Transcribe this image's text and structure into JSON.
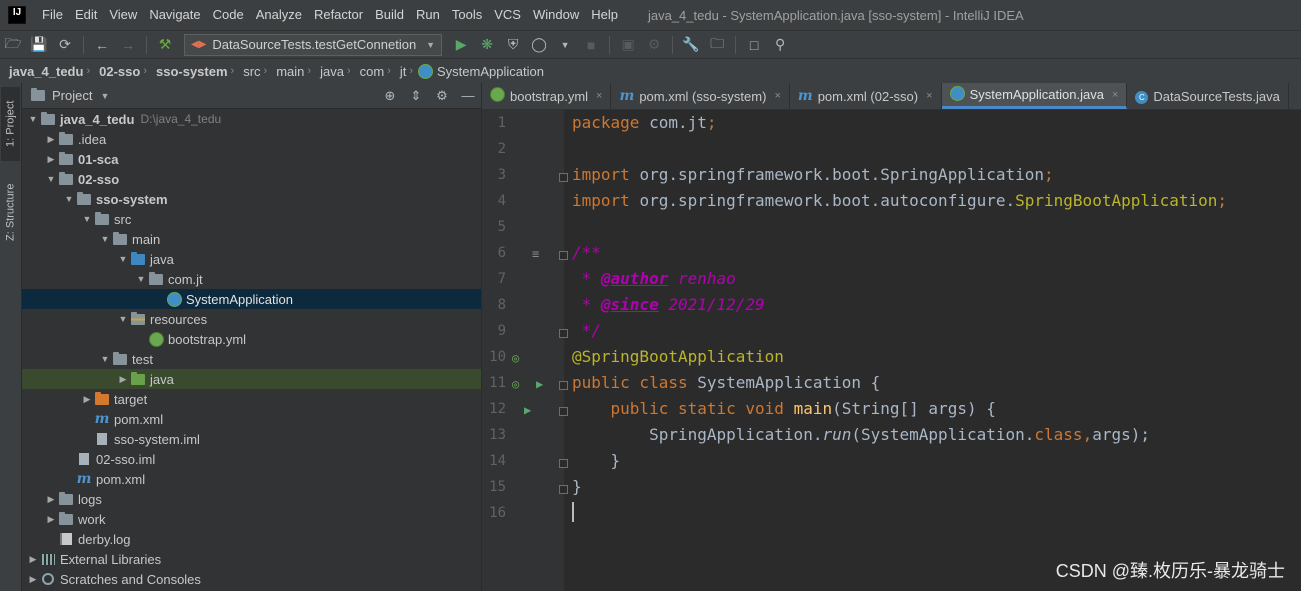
{
  "menubar": {
    "logo": "IJ",
    "items": [
      "File",
      "Edit",
      "View",
      "Navigate",
      "Code",
      "Analyze",
      "Refactor",
      "Build",
      "Run",
      "Tools",
      "VCS",
      "Window",
      "Help"
    ],
    "window_title": "java_4_tedu - SystemApplication.java [sso-system] - IntelliJ IDEA"
  },
  "toolbar": {
    "run_config": "DataSourceTests.testGetConnetion"
  },
  "navbar": {
    "crumbs": [
      "java_4_tedu",
      "02-sso",
      "sso-system",
      "src",
      "main",
      "java",
      "com",
      "jt",
      "SystemApplication"
    ]
  },
  "stripe": {
    "project_tab": "1: Project",
    "structure_tab": "Z: Structure"
  },
  "project_panel": {
    "title": "Project",
    "root_path": "D:\\java_4_tedu",
    "tree": [
      {
        "label": "java_4_tedu",
        "depth": 0,
        "open": true,
        "icon": "folder-gray",
        "bold": true
      },
      {
        "label": ".idea",
        "depth": 1,
        "open": false,
        "icon": "folder-gray"
      },
      {
        "label": "01-sca",
        "depth": 1,
        "open": false,
        "icon": "folder-gray",
        "bold": true
      },
      {
        "label": "02-sso",
        "depth": 1,
        "open": true,
        "icon": "folder-gray",
        "bold": true
      },
      {
        "label": "sso-system",
        "depth": 2,
        "open": true,
        "icon": "folder-gray",
        "bold": true
      },
      {
        "label": "src",
        "depth": 3,
        "open": true,
        "icon": "folder-gray"
      },
      {
        "label": "main",
        "depth": 4,
        "open": true,
        "icon": "folder-gray"
      },
      {
        "label": "java",
        "depth": 5,
        "open": true,
        "icon": "folder-blue"
      },
      {
        "label": "com.jt",
        "depth": 6,
        "open": true,
        "icon": "folder-gray"
      },
      {
        "label": "SystemApplication",
        "depth": 7,
        "leaf": true,
        "icon": "spring-class",
        "selected": true
      },
      {
        "label": "resources",
        "depth": 5,
        "open": true,
        "icon": "folder-resources"
      },
      {
        "label": "bootstrap.yml",
        "depth": 6,
        "leaf": true,
        "icon": "spring-leaf"
      },
      {
        "label": "test",
        "depth": 4,
        "open": true,
        "icon": "folder-gray"
      },
      {
        "label": "java",
        "depth": 5,
        "open": false,
        "icon": "folder-green",
        "highlight": true
      },
      {
        "label": "target",
        "depth": 3,
        "open": false,
        "icon": "folder-orange"
      },
      {
        "label": "pom.xml",
        "depth": 3,
        "leaf": true,
        "icon": "maven"
      },
      {
        "label": "sso-system.iml",
        "depth": 3,
        "leaf": true,
        "icon": "file"
      },
      {
        "label": "02-sso.iml",
        "depth": 2,
        "leaf": true,
        "icon": "file"
      },
      {
        "label": "pom.xml",
        "depth": 2,
        "leaf": true,
        "icon": "maven"
      },
      {
        "label": "logs",
        "depth": 1,
        "open": false,
        "icon": "folder-gray"
      },
      {
        "label": "work",
        "depth": 1,
        "open": false,
        "icon": "folder-gray"
      },
      {
        "label": "derby.log",
        "depth": 1,
        "leaf": true,
        "icon": "log"
      },
      {
        "label": "External Libraries",
        "depth": 0,
        "open": false,
        "icon": "library"
      },
      {
        "label": "Scratches and Consoles",
        "depth": 0,
        "open": false,
        "icon": "scratch"
      }
    ]
  },
  "editor_tabs": [
    {
      "label": "bootstrap.yml",
      "icon": "spring-leaf",
      "active": false
    },
    {
      "label": "pom.xml (sso-system)",
      "icon": "maven",
      "active": false
    },
    {
      "label": "pom.xml (02-sso)",
      "icon": "maven",
      "active": false
    },
    {
      "label": "SystemApplication.java",
      "icon": "spring-class",
      "active": true
    },
    {
      "label": "DataSourceTests.java",
      "icon": "class",
      "active": false
    }
  ],
  "editor": {
    "line_numbers": [
      "1",
      "2",
      "3",
      "4",
      "5",
      "6",
      "7",
      "8",
      "9",
      "10",
      "11",
      "12",
      "13",
      "14",
      "15",
      "16"
    ],
    "lines": [
      [
        {
          "t": "package ",
          "c": "kw"
        },
        {
          "t": "com.jt",
          "c": ""
        },
        {
          "t": ";",
          "c": "kw"
        }
      ],
      [],
      [
        {
          "t": "import ",
          "c": "kw"
        },
        {
          "t": "org.springframework.boot.SpringApplication",
          "c": ""
        },
        {
          "t": ";",
          "c": "kw"
        }
      ],
      [
        {
          "t": "import ",
          "c": "kw"
        },
        {
          "t": "org.springframework.boot.autoconfigure.",
          "c": ""
        },
        {
          "t": "SpringBootApplication",
          "c": "ann"
        },
        {
          "t": ";",
          "c": "kw"
        }
      ],
      [],
      [
        {
          "t": "/**",
          "c": "doc"
        }
      ],
      [
        {
          "t": " * ",
          "c": "doc"
        },
        {
          "t": "@author",
          "c": "doctag"
        },
        {
          "t": " renhao",
          "c": "doc"
        }
      ],
      [
        {
          "t": " * ",
          "c": "doc"
        },
        {
          "t": "@since",
          "c": "doctag"
        },
        {
          "t": " 2021/12/29",
          "c": "doc"
        }
      ],
      [
        {
          "t": " */",
          "c": "doc"
        }
      ],
      [
        {
          "t": "@SpringBootApplication",
          "c": "ann"
        }
      ],
      [
        {
          "t": "public class ",
          "c": "kw"
        },
        {
          "t": "SystemApplication {",
          "c": ""
        }
      ],
      [
        {
          "t": "    public static void ",
          "c": "kw"
        },
        {
          "t": "main",
          "c": "fn"
        },
        {
          "t": "(String[] args) {",
          "c": ""
        }
      ],
      [
        {
          "t": "        SpringApplication.",
          "c": ""
        },
        {
          "t": "run",
          "c": "it"
        },
        {
          "t": "(SystemApplication.",
          "c": ""
        },
        {
          "t": "class",
          "c": "kw"
        },
        {
          "t": ",",
          "c": "kw"
        },
        {
          "t": "args);",
          "c": ""
        }
      ],
      [
        {
          "t": "    }",
          "c": ""
        }
      ],
      [
        {
          "t": "}",
          "c": ""
        }
      ],
      []
    ]
  },
  "watermark": "CSDN @臻.枚历乐-暴龙骑士"
}
